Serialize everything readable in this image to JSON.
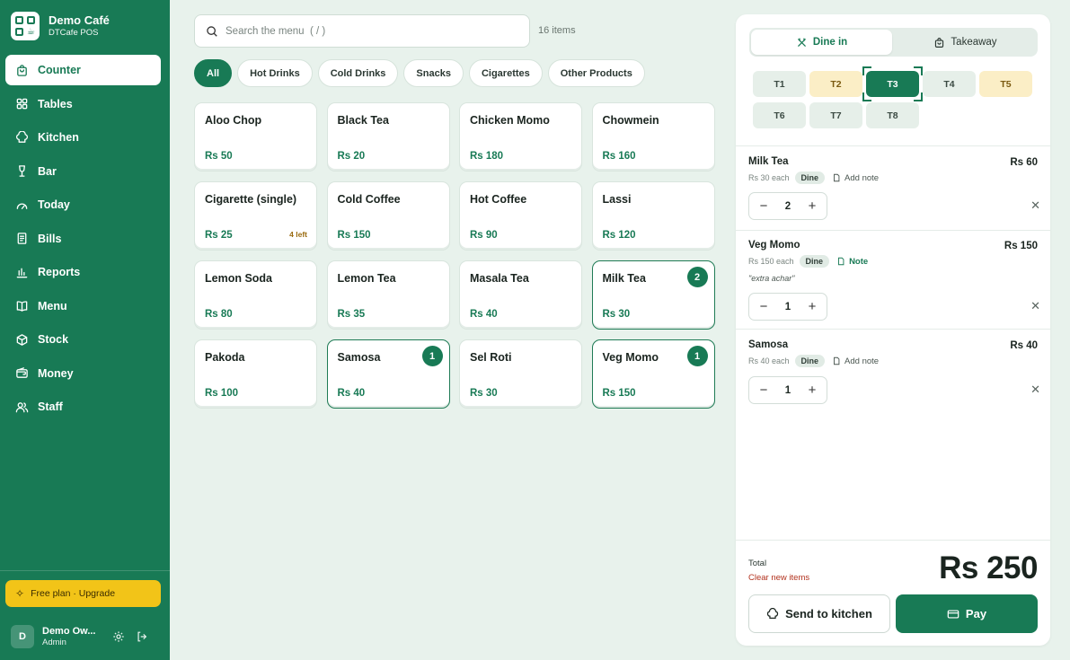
{
  "brand": {
    "title": "Demo Café",
    "subtitle": "DTCafe POS"
  },
  "nav": [
    {
      "label": "Counter",
      "icon": "bag-icon",
      "active": true
    },
    {
      "label": "Tables",
      "icon": "grid-icon"
    },
    {
      "label": "Kitchen",
      "icon": "chef-hat-icon"
    },
    {
      "label": "Bar",
      "icon": "wine-glass-icon"
    },
    {
      "label": "Today",
      "icon": "gauge-icon"
    },
    {
      "label": "Bills",
      "icon": "receipt-icon"
    },
    {
      "label": "Reports",
      "icon": "bar-chart-icon"
    },
    {
      "label": "Menu",
      "icon": "book-icon"
    },
    {
      "label": "Stock",
      "icon": "box-icon"
    },
    {
      "label": "Money",
      "icon": "wallet-icon"
    },
    {
      "label": "Staff",
      "icon": "users-icon"
    }
  ],
  "upgrade": {
    "label": "Free plan · Upgrade"
  },
  "user": {
    "initial": "D",
    "name": "Demo Ow...",
    "role": "Admin"
  },
  "search": {
    "placeholder": "Search the menu  ( / )",
    "count": "16 items"
  },
  "categories": [
    "All",
    "Hot Drinks",
    "Cold Drinks",
    "Snacks",
    "Cigarettes",
    "Other Products"
  ],
  "menu_items": [
    {
      "name": "Aloo Chop",
      "price": "Rs 50"
    },
    {
      "name": "Black Tea",
      "price": "Rs 20"
    },
    {
      "name": "Chicken Momo",
      "price": "Rs 180"
    },
    {
      "name": "Chowmein",
      "price": "Rs 160"
    },
    {
      "name": "Cigarette (single)",
      "price": "Rs 25",
      "stock": "4 left"
    },
    {
      "name": "Cold Coffee",
      "price": "Rs 150"
    },
    {
      "name": "Hot Coffee",
      "price": "Rs 90"
    },
    {
      "name": "Lassi",
      "price": "Rs 120"
    },
    {
      "name": "Lemon Soda",
      "price": "Rs 80"
    },
    {
      "name": "Lemon Tea",
      "price": "Rs 35"
    },
    {
      "name": "Masala Tea",
      "price": "Rs 40"
    },
    {
      "name": "Milk Tea",
      "price": "Rs 30",
      "count": "2"
    },
    {
      "name": "Pakoda",
      "price": "Rs 100"
    },
    {
      "name": "Samosa",
      "price": "Rs 40",
      "count": "1"
    },
    {
      "name": "Sel Roti",
      "price": "Rs 30"
    },
    {
      "name": "Veg Momo",
      "price": "Rs 150",
      "count": "1"
    }
  ],
  "order_mode": {
    "dine_in": "Dine in",
    "takeaway": "Takeaway"
  },
  "tables": [
    {
      "label": "T1",
      "state": "free"
    },
    {
      "label": "T2",
      "state": "busy"
    },
    {
      "label": "T3",
      "state": "active"
    },
    {
      "label": "T4",
      "state": "free"
    },
    {
      "label": "T5",
      "state": "busy"
    },
    {
      "label": "T6",
      "state": "free"
    },
    {
      "label": "T7",
      "state": "free"
    },
    {
      "label": "T8",
      "state": "free"
    }
  ],
  "order_items": [
    {
      "name": "Milk Tea",
      "each": "Rs 30 each",
      "tag": "Dine",
      "note_label": "Add note",
      "note": "",
      "qty": "2",
      "total": "Rs 60"
    },
    {
      "name": "Veg Momo",
      "each": "Rs 150 each",
      "tag": "Dine",
      "note_label": "Note",
      "note": "\"extra achar\"",
      "qty": "1",
      "total": "Rs 150"
    },
    {
      "name": "Samosa",
      "each": "Rs 40 each",
      "tag": "Dine",
      "note_label": "Add note",
      "note": "",
      "qty": "1",
      "total": "Rs 40"
    }
  ],
  "footer": {
    "total_label": "Total",
    "clear_label": "Clear new items",
    "total": "Rs 250",
    "kitchen_label": "Send to kitchen",
    "pay_label": "Pay"
  },
  "colors": {
    "brand": "#187a55",
    "accent_yellow": "#f2c418",
    "busy_table": "#fbeec6",
    "danger": "#b2321e"
  }
}
